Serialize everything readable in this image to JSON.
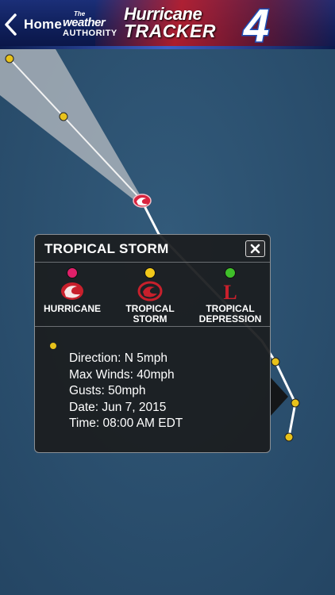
{
  "header": {
    "back_label": "Home",
    "authority_the": "The",
    "authority_weather": "weather",
    "authority_word": "AUTHORITY",
    "brand_line1": "Hurricane",
    "brand_line2": "TRACKER",
    "brand_number": "4"
  },
  "popup": {
    "title": "TROPICAL STORM",
    "close_label": "✕",
    "legend": [
      {
        "label_line1": "HURRICANE",
        "label_line2": "",
        "color": "#e0206a",
        "symbol": "hurricane-icon"
      },
      {
        "label_line1": "TROPICAL",
        "label_line2": "STORM",
        "color": "#f2c81a",
        "symbol": "tropical-storm-icon"
      },
      {
        "label_line1": "TROPICAL",
        "label_line2": "DEPRESSION",
        "color": "#3fbf2a",
        "symbol": "tropical-depression-icon"
      }
    ],
    "symbol_letter": "L",
    "details": {
      "direction": "Direction: N 5mph",
      "max_winds": "Max Winds: 40mph",
      "gusts": "Gusts: 50mph",
      "date": "Date: Jun 7, 2015",
      "time": "Time: 08:00 AM EDT"
    }
  },
  "colors": {
    "ocean": "#2a4d6b",
    "track_point": "#e8c21a",
    "cone": "#b9bec3",
    "track_line": "#ffffff",
    "storm_marker": "#d9233f"
  }
}
